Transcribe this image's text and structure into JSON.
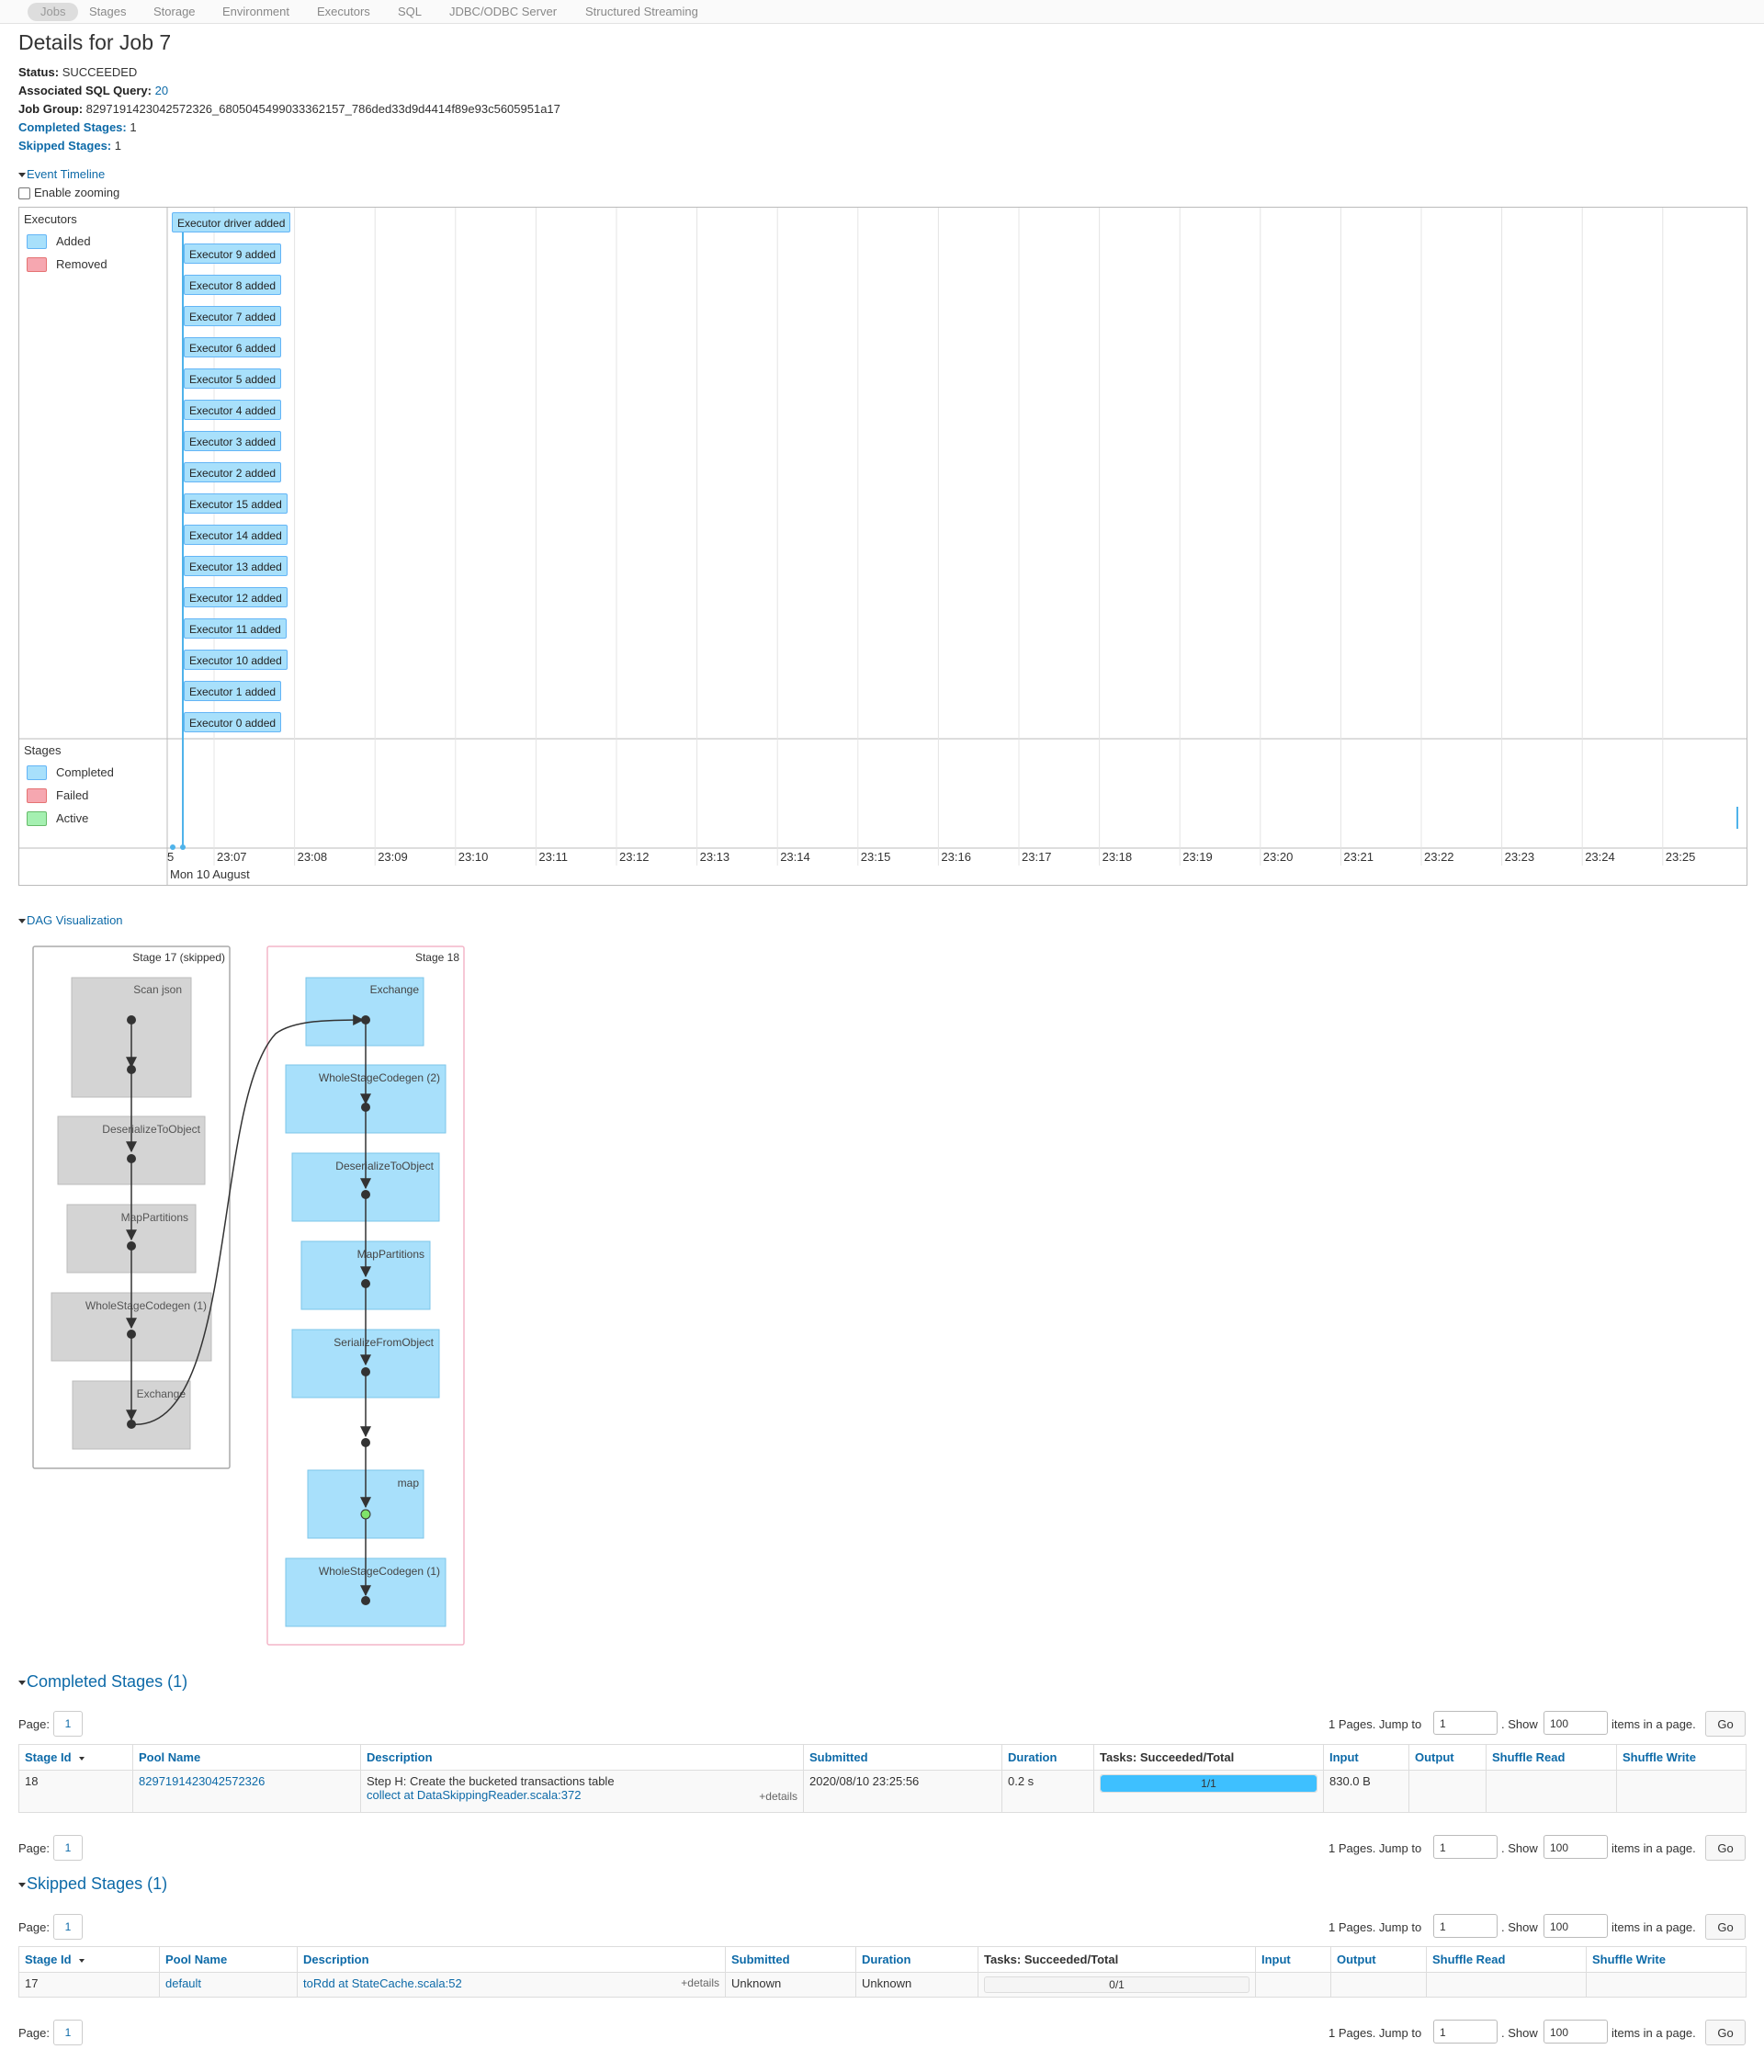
{
  "nav": {
    "tabs": [
      "Jobs",
      "Stages",
      "Storage",
      "Environment",
      "Executors",
      "SQL",
      "JDBC/ODBC Server",
      "Structured Streaming"
    ]
  },
  "title": "Details for Job 7",
  "details": {
    "status_label": "Status:",
    "status": "SUCCEEDED",
    "sql_label": "Associated SQL Query:",
    "sql": "20",
    "group_label": "Job Group:",
    "group": "8297191423042572326_6805045499033362157_786ded33d9d4414f89e93c5605951a17",
    "completed_label": "Completed Stages:",
    "completed": "1",
    "skipped_label": "Skipped Stages:",
    "skipped": "1"
  },
  "timeline": {
    "toggle": "Event Timeline",
    "zoom_label": "Enable zooming",
    "executors_label": "Executors",
    "exec_legend": {
      "added": "Added",
      "removed": "Removed"
    },
    "stages_label": "Stages",
    "stage_legend": {
      "completed": "Completed",
      "failed": "Failed",
      "active": "Active"
    },
    "events": [
      "Executor driver added",
      "Executor 9 added",
      "Executor 8 added",
      "Executor 7 added",
      "Executor 6 added",
      "Executor 5 added",
      "Executor 4 added",
      "Executor 3 added",
      "Executor 2 added",
      "Executor 15 added",
      "Executor 14 added",
      "Executor 13 added",
      "Executor 12 added",
      "Executor 11 added",
      "Executor 10 added",
      "Executor 1 added",
      "Executor 0 added"
    ],
    "first_tick": "5",
    "ticks": [
      "23:07",
      "23:08",
      "23:09",
      "23:10",
      "23:11",
      "23:12",
      "23:13",
      "23:14",
      "23:15",
      "23:16",
      "23:17",
      "23:18",
      "23:19",
      "23:20",
      "23:21",
      "23:22",
      "23:23",
      "23:24",
      "23:25"
    ],
    "date": "Mon 10 August",
    "colors": {
      "added": "#a8e0fb",
      "removed": "#f6a7b0",
      "completed": "#a8e0fb",
      "failed": "#f6a7b0",
      "active": "#a5f0b1"
    }
  },
  "dag": {
    "toggle": "DAG Visualization",
    "stage17": {
      "label": "Stage 17 (skipped)",
      "nodes": [
        "Scan json",
        "DeserializeToObject",
        "MapPartitions",
        "WholeStageCodegen (1)",
        "Exchange"
      ]
    },
    "stage18": {
      "label": "Stage 18",
      "nodes": [
        "Exchange",
        "WholeStageCodegen (2)",
        "DeserializeToObject",
        "MapPartitions",
        "SerializeFromObject",
        "map",
        "WholeStageCodegen (1)"
      ]
    }
  },
  "completed": {
    "heading": "Completed Stages (1)",
    "page_label": "Page:",
    "page": "1",
    "pages_text": "1 Pages. Jump to",
    "jump": "1",
    "show_label": ". Show",
    "show": "100",
    "items_label": "items in a page.",
    "go": "Go",
    "headers": [
      "Stage Id",
      "Pool Name",
      "Description",
      "Submitted",
      "Duration",
      "Tasks: Succeeded/Total",
      "Input",
      "Output",
      "Shuffle Read",
      "Shuffle Write"
    ],
    "row": {
      "id": "18",
      "pool": "8297191423042572326",
      "desc_title": "Step H: Create the bucketed transactions table",
      "desc_link": "collect at DataSkippingReader.scala:372",
      "details": "+details",
      "submitted": "2020/08/10 23:25:56",
      "duration": "0.2 s",
      "tasks": "1/1",
      "tasks_fraction": 1.0,
      "input": "830.0 B",
      "output": "",
      "shuffle_read": "",
      "shuffle_write": ""
    }
  },
  "skipped": {
    "heading": "Skipped Stages (1)",
    "page_label": "Page:",
    "page": "1",
    "pages_text": "1 Pages. Jump to",
    "jump": "1",
    "show_label": ". Show",
    "show": "100",
    "items_label": "items in a page.",
    "go": "Go",
    "headers": [
      "Stage Id",
      "Pool Name",
      "Description",
      "Submitted",
      "Duration",
      "Tasks: Succeeded/Total",
      "Input",
      "Output",
      "Shuffle Read",
      "Shuffle Write"
    ],
    "row": {
      "id": "17",
      "pool": "default",
      "desc_link": "toRdd at StateCache.scala:52",
      "details": "+details",
      "submitted": "Unknown",
      "duration": "Unknown",
      "tasks": "0/1",
      "tasks_fraction": 0.0,
      "input": "",
      "output": "",
      "shuffle_read": "",
      "shuffle_write": ""
    }
  }
}
